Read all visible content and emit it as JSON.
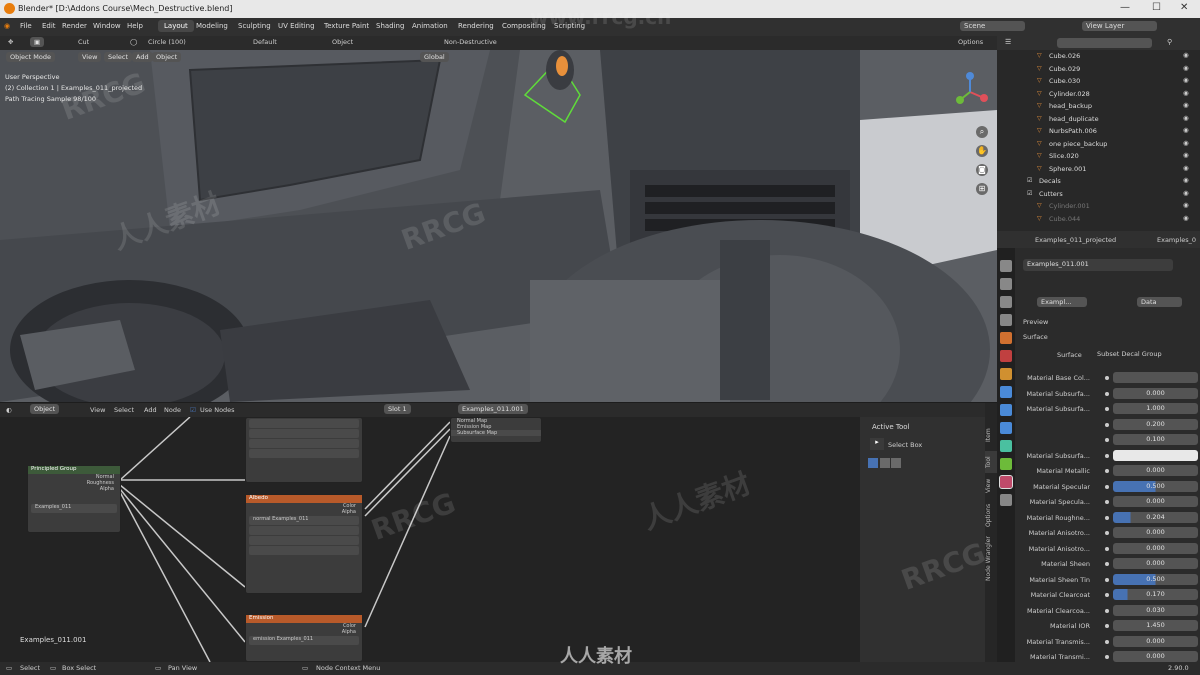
{
  "window": {
    "title": "Blender* [D:\\Addons Course\\Mech_Destructive.blend]"
  },
  "menu": {
    "items": [
      "File",
      "Edit",
      "Render",
      "Window",
      "Help"
    ],
    "workspaces": [
      "Layout",
      "Modeling",
      "Sculpting",
      "UV Editing",
      "Texture Paint",
      "Shading",
      "Animation",
      "Rendering",
      "Compositing",
      "Scripting"
    ],
    "active_workspace": "Layout",
    "scene_label": "Scene",
    "view_layer_label": "View Layer"
  },
  "toolbar": {
    "cut": "Cut",
    "circle": "Circle (100)",
    "default": "Default",
    "object": "Object",
    "non_destructive": "Non-Destructive",
    "options": "Options"
  },
  "viewport": {
    "mode": "Object Mode",
    "menus": [
      "View",
      "Select",
      "Add",
      "Object"
    ],
    "orientation": "Global",
    "info": [
      "User Perspective",
      "(2) Collection 1 | Examples_011_projected",
      "Path Tracing Sample 98/100"
    ]
  },
  "node_editor": {
    "type": "Object",
    "menus": [
      "View",
      "Select",
      "Add",
      "Node"
    ],
    "use_nodes": "Use Nodes",
    "slot": "Slot 1",
    "material": "Examples_011.001",
    "object_name": "Examples_011.001",
    "output_sockets": [
      "Normal Map",
      "Emission Map",
      "Subsurface Map"
    ],
    "node1": {
      "title": "Principled Group",
      "sockets": [
        "Normal",
        "Roughness",
        "Alpha"
      ],
      "image": "Examples_011"
    },
    "node2": {
      "title": "Albedo",
      "sockets": [
        "Color",
        "Alpha"
      ],
      "image": "normal Examples_011"
    },
    "node3": {
      "title": "Emission",
      "sockets": [
        "Color",
        "Alpha"
      ],
      "image": "emission Examples_011"
    }
  },
  "npanel": {
    "header": "Active Tool",
    "tool": "Select Box",
    "tabs": [
      "Item",
      "Tool",
      "View",
      "Options",
      "Node Wrangler"
    ]
  },
  "outliner": {
    "items": [
      "Cube.026",
      "Cube.029",
      "Cube.030",
      "Cylinder.028",
      "head_backup",
      "head_duplicate",
      "NurbsPath.006",
      "one piece_backup",
      "Slice.020",
      "Sphere.001",
      "Decals",
      "Cutters",
      "Cylinder.001",
      "Cube.044"
    ]
  },
  "properties": {
    "object": "Examples_011_projected",
    "object2": "Examples_0",
    "material_slot": "Examples_011.001",
    "material_field": "Exampl...",
    "data": "Data",
    "sections": {
      "preview": "Preview",
      "surface": "Surface"
    },
    "surface_value": "Subset Decal Group",
    "rows": [
      {
        "label": "Material Base Col...",
        "value": ""
      },
      {
        "label": "Material Subsurfa...",
        "value": "0.000"
      },
      {
        "label": "Material Subsurfa...",
        "value": "1.000"
      },
      {
        "label": "",
        "value": "0.200"
      },
      {
        "label": "",
        "value": "0.100"
      },
      {
        "label": "Material Subsurfa...",
        "value": ""
      },
      {
        "label": "Material Metallic",
        "value": "0.000"
      },
      {
        "label": "Material Specular",
        "value": "0.500"
      },
      {
        "label": "Material Specula...",
        "value": "0.000"
      },
      {
        "label": "Material Roughne...",
        "value": "0.204"
      },
      {
        "label": "Material Anisotro...",
        "value": "0.000"
      },
      {
        "label": "Material Anisotro...",
        "value": "0.000"
      },
      {
        "label": "Material Sheen",
        "value": "0.000"
      },
      {
        "label": "Material Sheen Tin",
        "value": "0.500"
      },
      {
        "label": "Material Clearcoat",
        "value": "0.170"
      },
      {
        "label": "Material Clearcoa...",
        "value": "0.030"
      },
      {
        "label": "Material IOR",
        "value": "1.450"
      },
      {
        "label": "Material Transmis...",
        "value": "0.000"
      },
      {
        "label": "Material Transmi...",
        "value": "0.000"
      }
    ]
  },
  "status": {
    "select": "Select",
    "box_select": "Box Select",
    "pan_view": "Pan View",
    "context_menu": "Node Context Menu",
    "version": "2.90.0"
  },
  "watermark": {
    "text1": "RRCG",
    "text2": "人人素材",
    "url": "www.rrcg.cn"
  },
  "colors": {
    "accent": "#e87d0d",
    "header": "#303030",
    "field": "#545454",
    "slider": "#4772b3"
  }
}
